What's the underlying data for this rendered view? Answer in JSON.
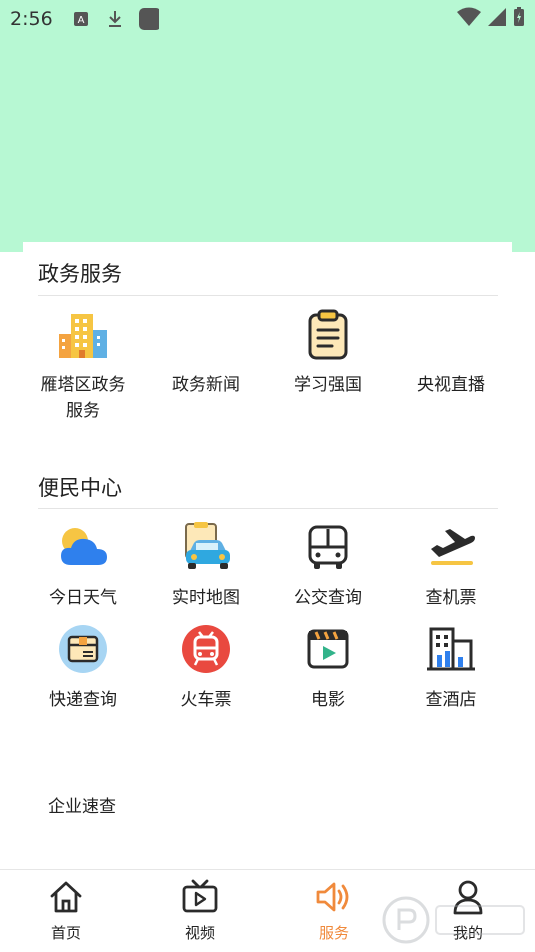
{
  "status_bar": {
    "time": "2:56",
    "icons": [
      "text-a-icon",
      "download-icon",
      "app-square-icon",
      "wifi-icon",
      "signal-icon",
      "battery-icon"
    ]
  },
  "sections": {
    "gov": {
      "title": "政务服务",
      "items": [
        {
          "label": "雁塔区政务服务",
          "icon": "office-building-icon"
        },
        {
          "label": "政务新闻",
          "icon": ""
        },
        {
          "label": "学习强国",
          "icon": "clipboard-icon"
        },
        {
          "label": "央视直播",
          "icon": ""
        }
      ]
    },
    "convenience": {
      "title": "便民中心",
      "items": [
        {
          "label": "今日天气",
          "icon": "weather-icon"
        },
        {
          "label": "实时地图",
          "icon": "map-car-icon"
        },
        {
          "label": "公交查询",
          "icon": "bus-icon"
        },
        {
          "label": "查机票",
          "icon": "plane-icon"
        },
        {
          "label": "快递查询",
          "icon": "parcel-icon"
        },
        {
          "label": "火车票",
          "icon": "train-icon"
        },
        {
          "label": "电影",
          "icon": "movie-icon"
        },
        {
          "label": "查酒店",
          "icon": "hotel-icon"
        }
      ]
    }
  },
  "extra_link": {
    "label": "企业速查"
  },
  "tabbar": {
    "items": [
      {
        "label": "首页",
        "icon": "home-icon"
      },
      {
        "label": "视频",
        "icon": "tv-icon"
      },
      {
        "label": "服务",
        "icon": "speaker-icon",
        "active": true
      },
      {
        "label": "我的",
        "icon": "user-icon"
      }
    ]
  },
  "colors": {
    "banner": "#b7f8d3",
    "active_tab": "#f08a3c",
    "text": "#222222"
  }
}
